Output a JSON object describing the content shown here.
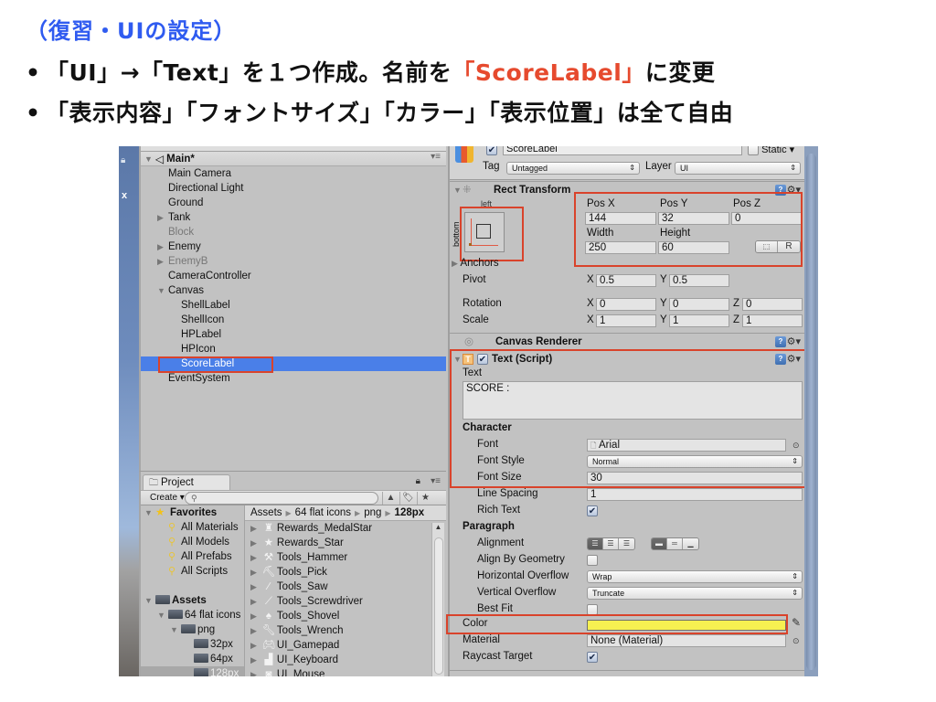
{
  "slide": {
    "title": "（復習・UIの設定）",
    "bullets": [
      {
        "dot": "•",
        "pre": "「UI」→「Text」を１つ作成。名前を",
        "accent": "「ScoreLabel」",
        "post": "に変更"
      },
      {
        "dot": "•",
        "pre": "「表示内容」「フォントサイズ」「カラー」「表示位置」は全て自由",
        "accent": "",
        "post": ""
      }
    ],
    "accent_color": "#e64a2e",
    "title_color": "#2f5bf0"
  },
  "scene_strip": {
    "lock_icon": "lock-icon",
    "close_label": "x"
  },
  "hierarchy": {
    "scene_name": "Main*",
    "menu_icon": "▾≡",
    "items": [
      {
        "label": "Main Camera",
        "depth": 1,
        "expander": "",
        "dim": false
      },
      {
        "label": "Directional Light",
        "depth": 1,
        "expander": "",
        "dim": false
      },
      {
        "label": "Ground",
        "depth": 1,
        "expander": "",
        "dim": false
      },
      {
        "label": "Tank",
        "depth": 1,
        "expander": "▶",
        "dim": false
      },
      {
        "label": "Block",
        "depth": 1,
        "expander": "",
        "dim": true
      },
      {
        "label": "Enemy",
        "depth": 1,
        "expander": "▶",
        "dim": false
      },
      {
        "label": "EnemyB",
        "depth": 1,
        "expander": "▶",
        "dim": true
      },
      {
        "label": "CameraController",
        "depth": 1,
        "expander": "",
        "dim": false
      },
      {
        "label": "Canvas",
        "depth": 1,
        "expander": "▼",
        "dim": false
      },
      {
        "label": "ShellLabel",
        "depth": 2,
        "expander": "",
        "dim": false
      },
      {
        "label": "ShellIcon",
        "depth": 2,
        "expander": "",
        "dim": false
      },
      {
        "label": "HPLabel",
        "depth": 2,
        "expander": "",
        "dim": false
      },
      {
        "label": "HPIcon",
        "depth": 2,
        "expander": "",
        "dim": false
      },
      {
        "label": "ScoreLabel",
        "depth": 2,
        "expander": "",
        "dim": false,
        "selected": true
      },
      {
        "label": "EventSystem",
        "depth": 1,
        "expander": "",
        "dim": false
      }
    ]
  },
  "project": {
    "tab_label": "Project",
    "create_label": "Create ▾",
    "search_placeholder": "",
    "favorites": {
      "label": "Favorites",
      "items": [
        "All Materials",
        "All Models",
        "All Prefabs",
        "All Scripts"
      ]
    },
    "assets_tree": [
      {
        "label": "Assets",
        "depth": 0,
        "expander": "▼",
        "bold": true
      },
      {
        "label": "64 flat icons",
        "depth": 1,
        "expander": "▼"
      },
      {
        "label": "png",
        "depth": 2,
        "expander": "▼"
      },
      {
        "label": "32px",
        "depth": 3,
        "expander": ""
      },
      {
        "label": "64px",
        "depth": 3,
        "expander": ""
      },
      {
        "label": "128px",
        "depth": 3,
        "expander": "",
        "selected": true
      }
    ],
    "breadcrumb": [
      "Assets",
      "64 flat icons",
      "png",
      "128px"
    ],
    "assets": [
      {
        "name": "Rewards_MedalStar",
        "icon": "medal-icon"
      },
      {
        "name": "Rewards_Star",
        "icon": "star-icon"
      },
      {
        "name": "Tools_Hammer",
        "icon": "hammer-icon"
      },
      {
        "name": "Tools_Pick",
        "icon": "pick-icon"
      },
      {
        "name": "Tools_Saw",
        "icon": "saw-icon"
      },
      {
        "name": "Tools_Screwdriver",
        "icon": "screwdriver-icon"
      },
      {
        "name": "Tools_Shovel",
        "icon": "shovel-icon"
      },
      {
        "name": "Tools_Wrench",
        "icon": "wrench-icon"
      },
      {
        "name": "UI_Gamepad",
        "icon": "gamepad-icon"
      },
      {
        "name": "UI_Keyboard",
        "icon": "keyboard-icon"
      },
      {
        "name": "UI_Mouse",
        "icon": "mouse-icon"
      }
    ]
  },
  "inspector": {
    "object_name": "ScoreLabel",
    "active": true,
    "static_label": "Static",
    "tag_label": "Tag",
    "tag_value": "Untagged",
    "layer_label": "Layer",
    "layer_value": "UI",
    "rect_transform": {
      "title": "Rect Transform",
      "anchor_h": "left",
      "anchor_v": "bottom",
      "pos_x_label": "Pos X",
      "pos_x": "144",
      "pos_y_label": "Pos Y",
      "pos_y": "32",
      "pos_z_label": "Pos Z",
      "pos_z": "0",
      "width_label": "Width",
      "width": "250",
      "height_label": "Height",
      "height": "60",
      "raw_btn": "R",
      "anchors_label": "Anchors",
      "pivot_label": "Pivot",
      "pivot_x": "0.5",
      "pivot_y": "0.5",
      "rotation_label": "Rotation",
      "rot_x": "0",
      "rot_y": "0",
      "rot_z": "0",
      "scale_label": "Scale",
      "scale_x": "1",
      "scale_y": "1",
      "scale_z": "1",
      "axis_x": "X",
      "axis_y": "Y",
      "axis_z": "Z"
    },
    "canvas_renderer": {
      "title": "Canvas Renderer"
    },
    "text_script": {
      "title": "Text (Script)",
      "enabled": true,
      "text_label": "Text",
      "text_value": "SCORE :",
      "character_label": "Character",
      "font_label": "Font",
      "font_value": "Arial",
      "font_style_label": "Font Style",
      "font_style_value": "Normal",
      "font_size_label": "Font Size",
      "font_size_value": "30",
      "line_spacing_label": "Line Spacing",
      "line_spacing_value": "1",
      "rich_text_label": "Rich Text",
      "rich_text": true,
      "paragraph_label": "Paragraph",
      "alignment_label": "Alignment",
      "alignment_h": "left",
      "alignment_v": "top",
      "align_by_geometry_label": "Align By Geometry",
      "align_by_geometry": false,
      "h_overflow_label": "Horizontal Overflow",
      "h_overflow_value": "Wrap",
      "v_overflow_label": "Vertical Overflow",
      "v_overflow_value": "Truncate",
      "best_fit_label": "Best Fit",
      "best_fit": false,
      "color_label": "Color",
      "color_value": "#f6f051",
      "material_label": "Material",
      "material_value": "None (Material)",
      "raycast_label": "Raycast Target",
      "raycast": true
    }
  },
  "highlight_color": "#d9432b"
}
